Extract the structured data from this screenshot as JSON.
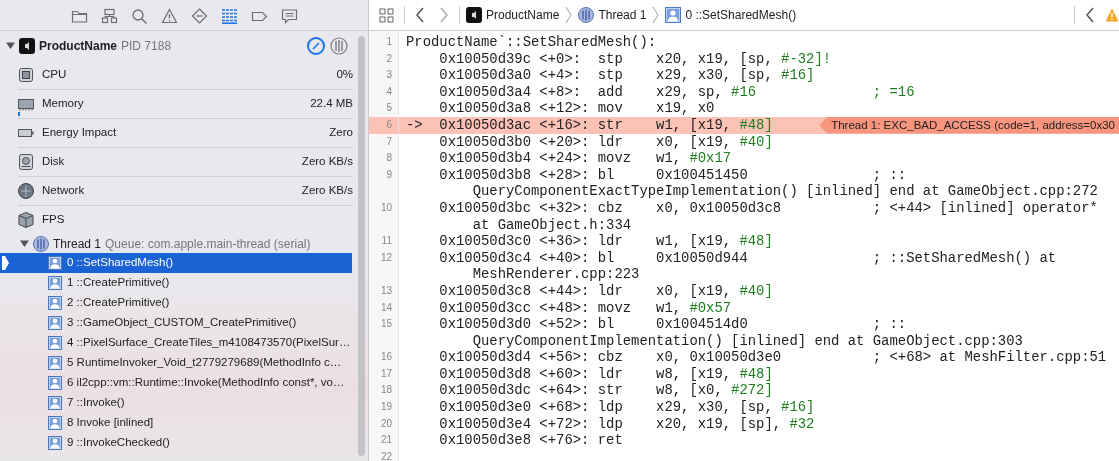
{
  "navigator_tabs": [
    {
      "selected": false
    },
    {
      "selected": false
    },
    {
      "selected": false
    },
    {
      "selected": false
    },
    {
      "selected": false
    },
    {
      "selected": true
    },
    {
      "selected": false
    },
    {
      "selected": false
    }
  ],
  "process": {
    "name": "ProductName",
    "pid": "PID 7188",
    "expanded": true
  },
  "metrics": [
    {
      "kind": "cpu",
      "label": "CPU",
      "value": "0%"
    },
    {
      "kind": "memory",
      "label": "Memory",
      "value": "22.4 MB",
      "level": 0.01
    },
    {
      "kind": "energy",
      "label": "Energy Impact",
      "value": "Zero"
    },
    {
      "kind": "disk",
      "label": "Disk",
      "value": "Zero KB/s"
    },
    {
      "kind": "network",
      "label": "Network",
      "value": "Zero KB/s"
    },
    {
      "kind": "fps",
      "label": "FPS"
    }
  ],
  "thread": {
    "label": "Thread 1",
    "queue": "Queue: com.apple.main-thread (serial)",
    "expanded": true
  },
  "frames": [
    {
      "label": "0 ::SetSharedMesh()",
      "selected": true
    },
    {
      "label": "1 ::CreatePrimitive()",
      "selected": false
    },
    {
      "label": "2 ::CreatePrimitive()",
      "selected": false
    },
    {
      "label": "3 ::GameObject_CUSTOM_CreatePrimitive()",
      "selected": false
    },
    {
      "label": "4 ::PixelSurface_CreateTiles_m4108473570(PixelSur…",
      "selected": false
    },
    {
      "label": "5 RuntimeInvoker_Void_t2779279689(MethodInfo c…",
      "selected": false
    },
    {
      "label": "6 il2cpp::vm::Runtime::Invoke(MethodInfo const*, vo…",
      "selected": false
    },
    {
      "label": "7 ::Invoke()",
      "selected": false
    },
    {
      "label": "8 Invoke [inlined]",
      "selected": false
    },
    {
      "label": "9 ::InvokeChecked()",
      "selected": false
    }
  ],
  "jump_bar": [
    {
      "kind": "app",
      "label": "ProductName"
    },
    {
      "kind": "thread",
      "label": "Thread 1"
    },
    {
      "kind": "frame",
      "label": "0 ::SetSharedMesh()"
    }
  ],
  "code_lines": [
    {
      "number": "1",
      "parts": [
        {
          "kind": "plain",
          "text": "ProductName`::SetSharedMesh():"
        }
      ]
    },
    {
      "number": "2",
      "parts": [
        {
          "kind": "plain",
          "text": "    0x10050d39c <+0>:  stp    x20, x19, [sp, "
        },
        {
          "kind": "immediate",
          "text": "#-32]!"
        }
      ]
    },
    {
      "number": "3",
      "parts": [
        {
          "kind": "plain",
          "text": "    0x10050d3a0 <+4>:  stp    x29, x30, [sp, "
        },
        {
          "kind": "immediate",
          "text": "#16]"
        }
      ]
    },
    {
      "number": "4",
      "parts": [
        {
          "kind": "plain",
          "text": "    0x10050d3a4 <+8>:  add    x29, sp, "
        },
        {
          "kind": "immediate",
          "text": "#16              ; =16"
        }
      ]
    },
    {
      "number": "5",
      "parts": [
        {
          "kind": "plain",
          "text": "    0x10050d3a8 <+12>: mov    x19, x0"
        }
      ]
    },
    {
      "number": "6",
      "current": true,
      "pointer": "->",
      "annotation": "Thread 1: EXC_BAD_ACCESS (code=1, address=0x30",
      "parts": [
        {
          "kind": "plain",
          "text": "  0x10050d3ac <+16>: str    w1, [x19, "
        },
        {
          "kind": "immediate",
          "text": "#48]"
        }
      ]
    },
    {
      "number": "7",
      "parts": [
        {
          "kind": "plain",
          "text": "    0x10050d3b0 <+20>: ldr    x0, [x19, "
        },
        {
          "kind": "immediate",
          "text": "#40]"
        }
      ]
    },
    {
      "number": "8",
      "parts": [
        {
          "kind": "plain",
          "text": "    0x10050d3b4 <+24>: movz   w1, "
        },
        {
          "kind": "immediate",
          "text": "#0x17"
        }
      ]
    },
    {
      "number": "9",
      "parts": [
        {
          "kind": "plain",
          "text": "    0x10050d3b8 <+28>: bl     0x100451450               ; ::"
        }
      ],
      "wrap": "QueryComponentExactTypeImplementation() [inlined] end at GameObject.cpp:272"
    },
    {
      "number": "10",
      "parts": [
        {
          "kind": "plain",
          "text": "    0x10050d3bc <+32>: cbz    x0, 0x10050d3c8           ; <+44> [inlined] operator*"
        }
      ],
      "wrap": "at GameObject.h:334"
    },
    {
      "number": "11",
      "parts": [
        {
          "kind": "plain",
          "text": "    0x10050d3c0 <+36>: ldr    w1, [x19, "
        },
        {
          "kind": "immediate",
          "text": "#48]"
        }
      ]
    },
    {
      "number": "12",
      "parts": [
        {
          "kind": "plain",
          "text": "    0x10050d3c4 <+40>: bl     0x10050d944               ; ::SetSharedMesh() at"
        }
      ],
      "wrap": "MeshRenderer.cpp:223"
    },
    {
      "number": "13",
      "parts": [
        {
          "kind": "plain",
          "text": "    0x10050d3c8 <+44>: ldr    x0, [x19, "
        },
        {
          "kind": "immediate",
          "text": "#40]"
        }
      ]
    },
    {
      "number": "14",
      "parts": [
        {
          "kind": "plain",
          "text": "    0x10050d3cc <+48>: movz   w1, "
        },
        {
          "kind": "immediate",
          "text": "#0x57"
        }
      ]
    },
    {
      "number": "15",
      "parts": [
        {
          "kind": "plain",
          "text": "    0x10050d3d0 <+52>: bl     0x1004514d0               ; ::"
        }
      ],
      "wrap": "QueryComponentImplementation() [inlined] end at GameObject.cpp:303"
    },
    {
      "number": "16",
      "parts": [
        {
          "kind": "plain",
          "text": "    0x10050d3d4 <+56>: cbz    x0, 0x10050d3e0           ; <+68> at MeshFilter.cpp:51"
        }
      ]
    },
    {
      "number": "17",
      "parts": [
        {
          "kind": "plain",
          "text": "    0x10050d3d8 <+60>: ldr    w8, [x19, "
        },
        {
          "kind": "immediate",
          "text": "#48]"
        }
      ]
    },
    {
      "number": "18",
      "parts": [
        {
          "kind": "plain",
          "text": "    0x10050d3dc <+64>: str    w8, [x0, "
        },
        {
          "kind": "immediate",
          "text": "#272]"
        }
      ]
    },
    {
      "number": "19",
      "parts": [
        {
          "kind": "plain",
          "text": "    0x10050d3e0 <+68>: ldp    x29, x30, [sp, "
        },
        {
          "kind": "immediate",
          "text": "#16]"
        }
      ]
    },
    {
      "number": "20",
      "parts": [
        {
          "kind": "plain",
          "text": "    0x10050d3e4 <+72>: ldp    x20, x19, [sp], "
        },
        {
          "kind": "immediate",
          "text": "#32"
        }
      ]
    },
    {
      "number": "21",
      "parts": [
        {
          "kind": "plain",
          "text": "    0x10050d3e8 <+76>: ret"
        }
      ]
    },
    {
      "number": "22"
    }
  ]
}
